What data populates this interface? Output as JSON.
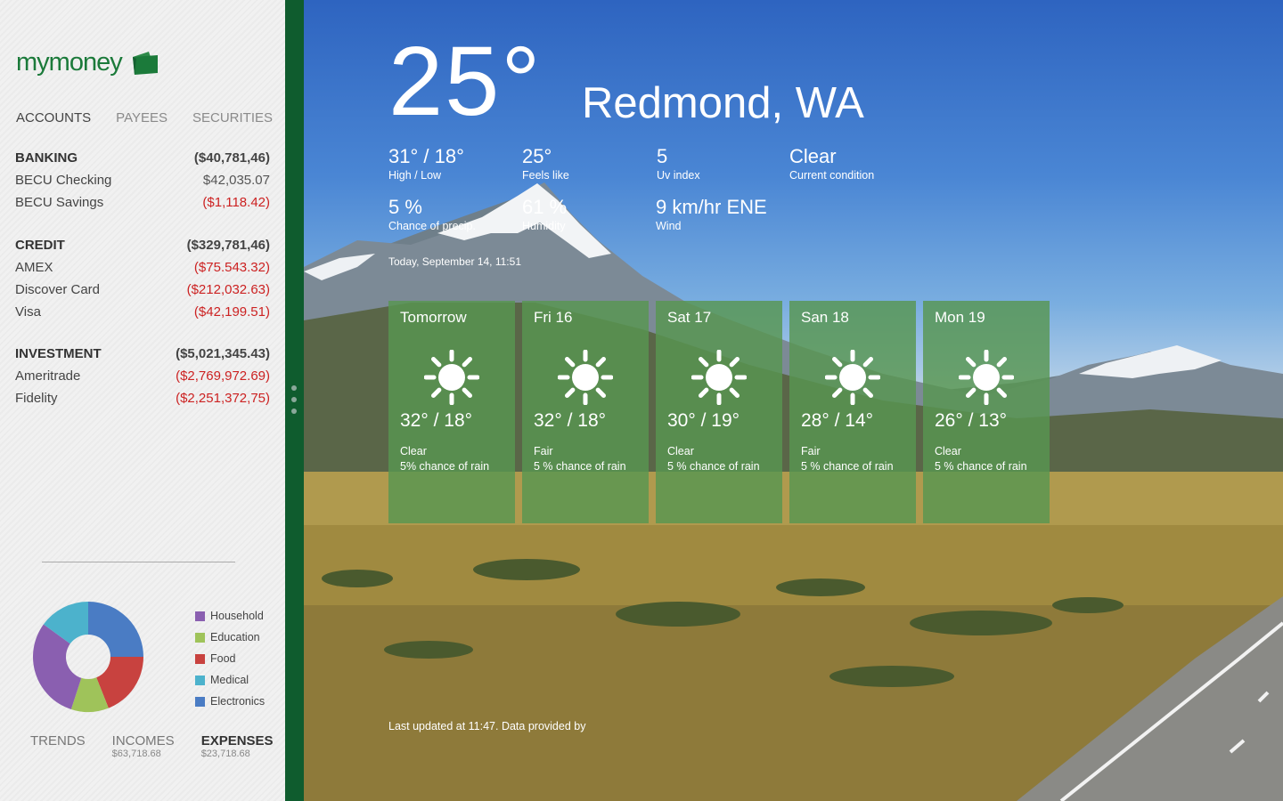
{
  "brand": {
    "name": "mymoney",
    "color": "#1b7a3a"
  },
  "account_tabs": [
    "ACCOUNTS",
    "PAYEES",
    "SECURITIES"
  ],
  "groups": [
    {
      "name": "BANKING",
      "total": "($40,781,46)",
      "accounts": [
        {
          "name": "BECU Checking",
          "amount": "$42,035.07",
          "negative": false
        },
        {
          "name": "BECU Savings",
          "amount": "($1,118.42)",
          "negative": true
        }
      ]
    },
    {
      "name": "CREDIT",
      "total": "($329,781,46)",
      "accounts": [
        {
          "name": "AMEX",
          "amount": "($75.543.32)",
          "negative": true
        },
        {
          "name": "Discover Card",
          "amount": "($212,032.63)",
          "negative": true
        },
        {
          "name": "Visa",
          "amount": "($42,199.51)",
          "negative": true
        }
      ]
    },
    {
      "name": "INVESTMENT",
      "total": "($5,021,345.43)",
      "accounts": [
        {
          "name": "Ameritrade",
          "amount": "($2,769,972.69)",
          "negative": true
        },
        {
          "name": "Fidelity",
          "amount": "($2,251,372,75)",
          "negative": true
        }
      ]
    }
  ],
  "legend": [
    {
      "label": "Household",
      "color": "#8a5fb0"
    },
    {
      "label": "Education",
      "color": "#9fc35a"
    },
    {
      "label": "Food",
      "color": "#c8423f"
    },
    {
      "label": "Medical",
      "color": "#4cb2cc"
    },
    {
      "label": "Electronics",
      "color": "#4a7cc4"
    }
  ],
  "donut_shares": [
    {
      "label": "Electronics",
      "percent": 25,
      "color": "#4a7cc4"
    },
    {
      "label": "Food",
      "percent": 19,
      "color": "#c8423f"
    },
    {
      "label": "Education",
      "percent": 11,
      "color": "#9fc35a"
    },
    {
      "label": "Household",
      "percent": 30,
      "color": "#8a5fb0"
    },
    {
      "label": "Medical",
      "percent": 15,
      "color": "#4cb2cc"
    }
  ],
  "bottom_tabs": [
    {
      "label": "TRENDS",
      "sub": ""
    },
    {
      "label": "INCOMES",
      "sub": "$63,718.68"
    },
    {
      "label": "EXPENSES",
      "sub": "$23,718.68"
    }
  ],
  "weather": {
    "temperature": "25°",
    "city": "Redmond, WA",
    "stats": [
      {
        "value": "31° / 18°",
        "label": "High / Low"
      },
      {
        "value": "25°",
        "label": "Feels like"
      },
      {
        "value": "5",
        "label": "Uv index"
      },
      {
        "value": "Clear",
        "label": "Current condition"
      },
      {
        "value": "5 %",
        "label": "Chance of precip."
      },
      {
        "value": "61 %",
        "label": "Humidity"
      },
      {
        "value": "9 km/hr ENE",
        "label": "Wind"
      }
    ],
    "today": "Today, September 14, 11:51",
    "forecast": [
      {
        "day": "Tomorrow",
        "temps": "32° / 18°",
        "condition": "Clear",
        "rain": "5% chance of rain"
      },
      {
        "day": "Fri 16",
        "temps": "32° / 18°",
        "condition": "Fair",
        "rain": "5 % chance of rain"
      },
      {
        "day": "Sat 17",
        "temps": "30° / 19°",
        "condition": "Clear",
        "rain": "5 % chance of rain"
      },
      {
        "day": "San 18",
        "temps": "28° / 14°",
        "condition": "Fair",
        "rain": "5 % chance of rain"
      },
      {
        "day": "Mon 19",
        "temps": "26° / 13°",
        "condition": "Clear",
        "rain": "5 % chance of rain"
      }
    ],
    "updated": "Last updated at 11:47. Data provided by"
  }
}
